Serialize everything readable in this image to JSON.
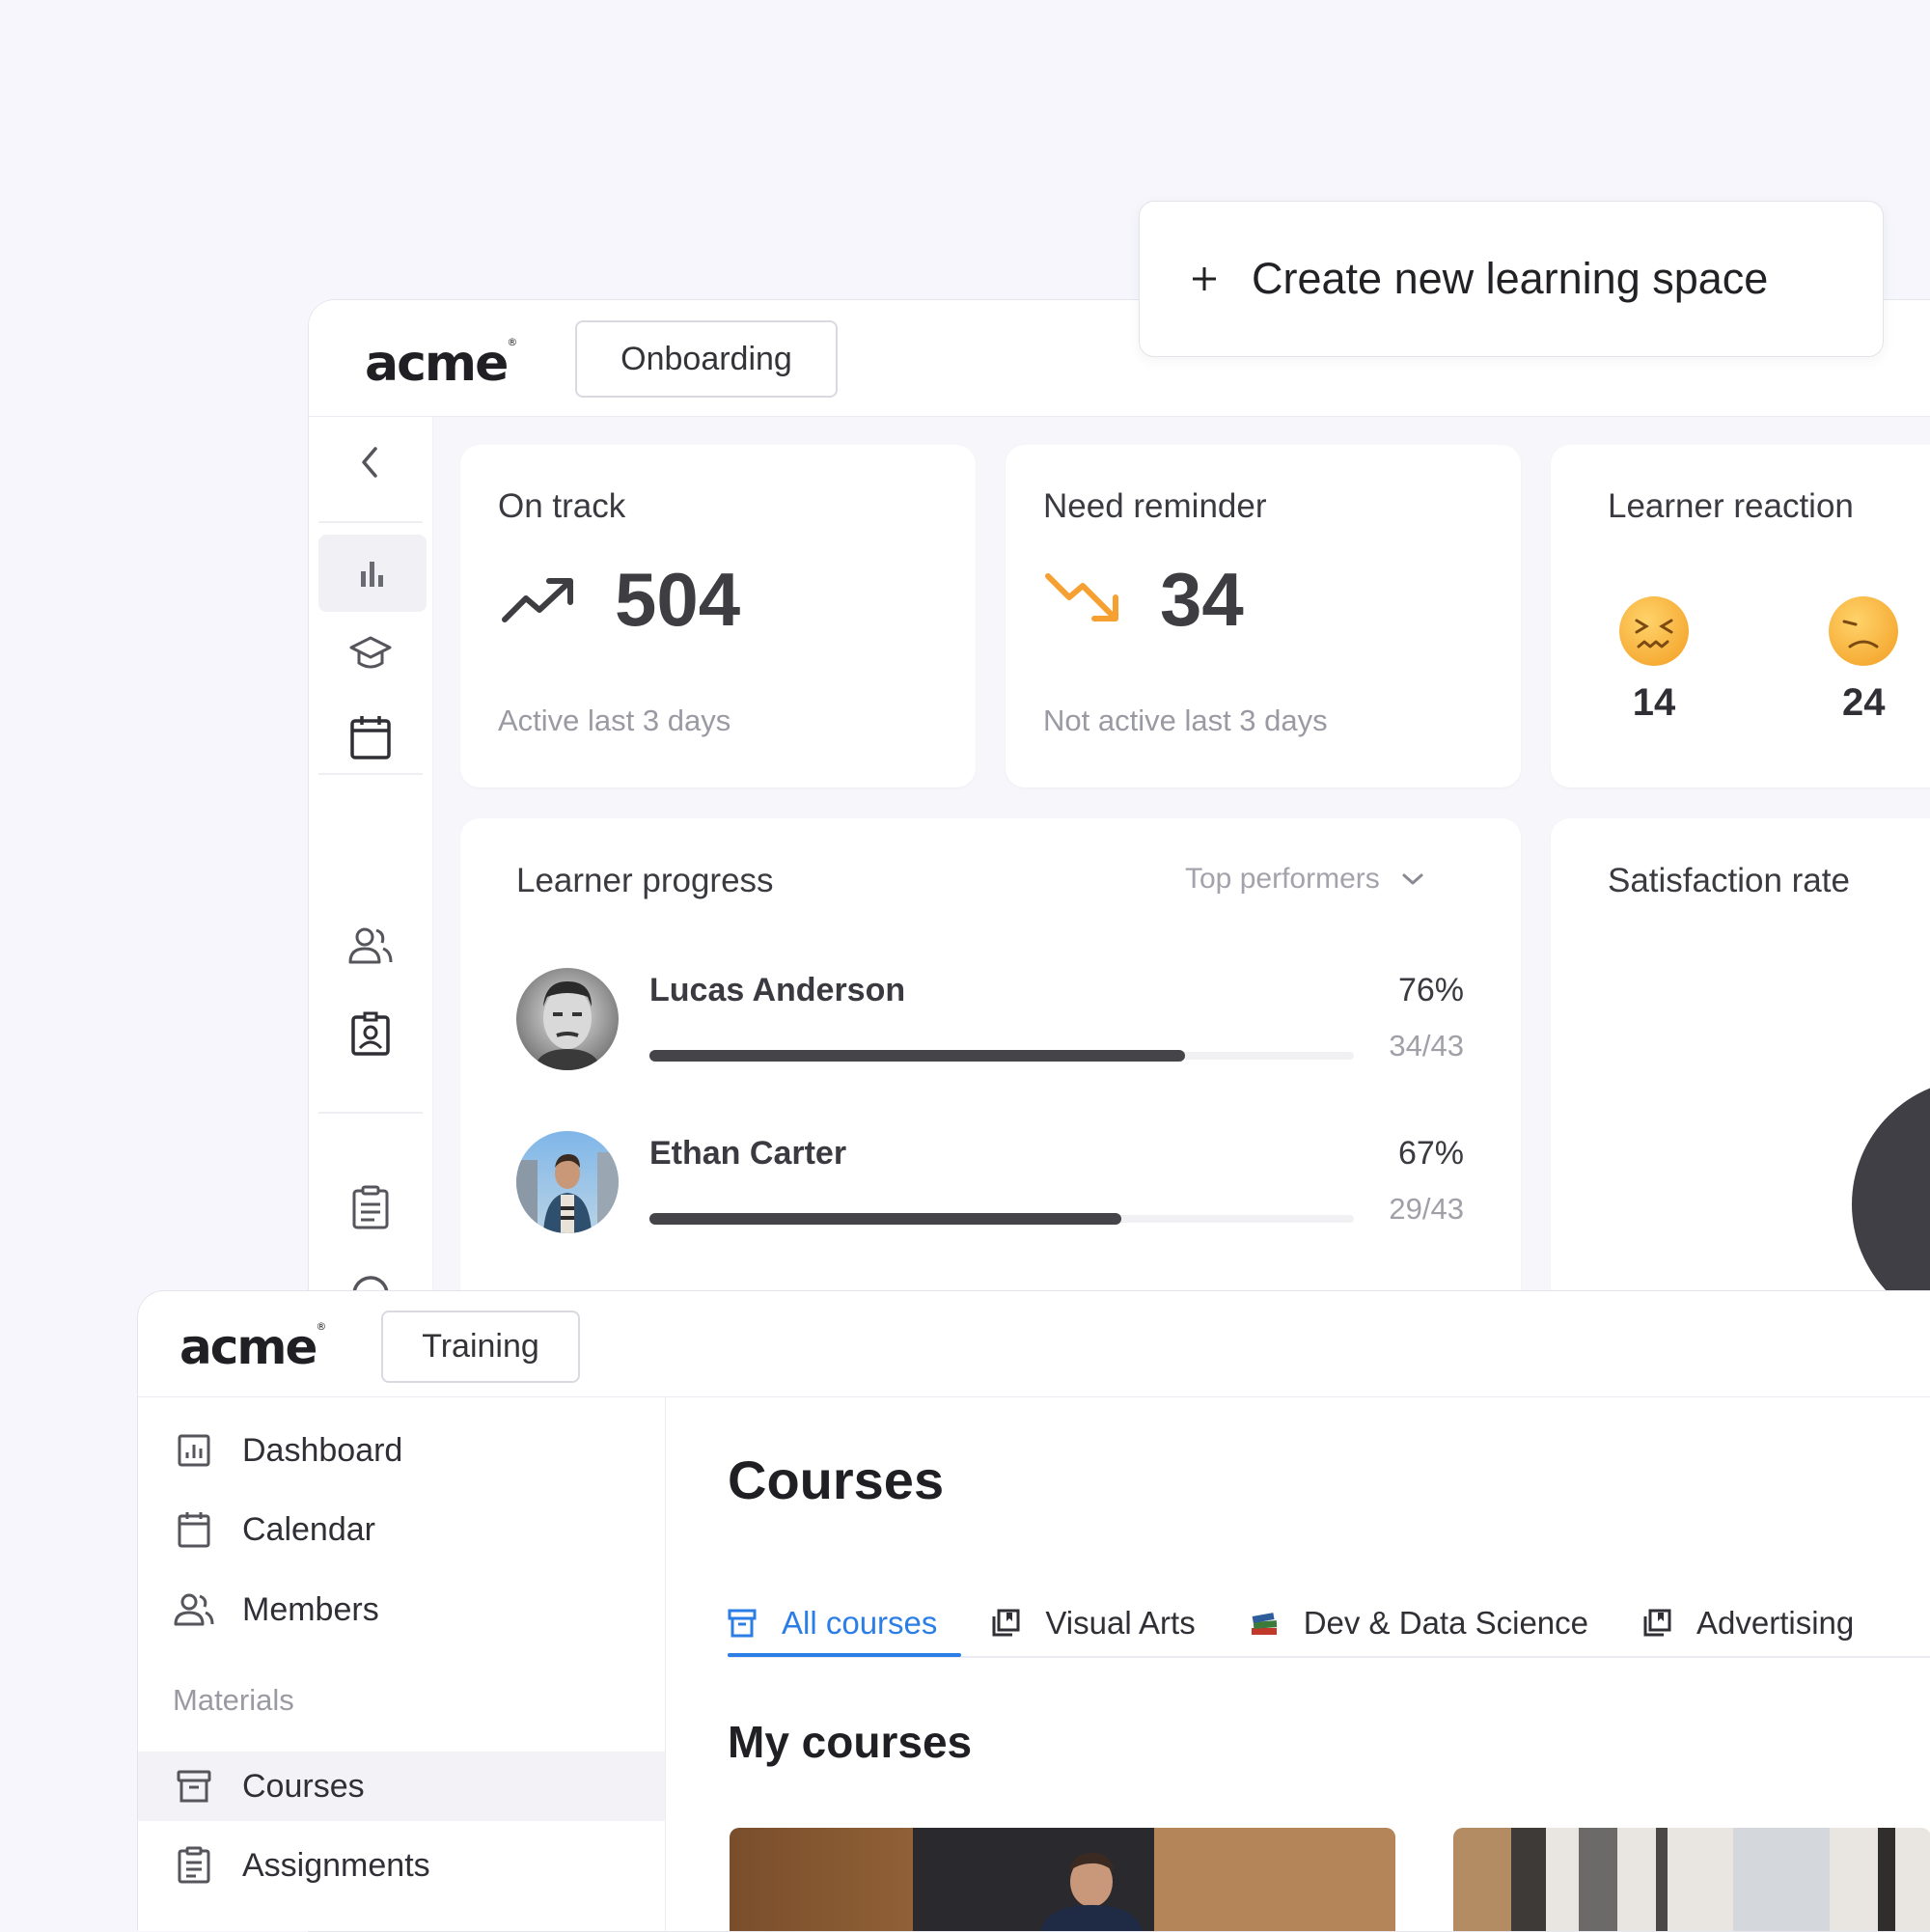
{
  "back_window": {
    "logo": "acme",
    "space_label": "Onboarding",
    "stats": {
      "on_track": {
        "title": "On track",
        "value": "504",
        "caption": "Active last 3 days"
      },
      "need_reminder": {
        "title": "Need reminder",
        "value": "34",
        "caption": "Not active last 3 days"
      },
      "learner_reaction": {
        "title": "Learner reaction",
        "counts": [
          "14",
          "24"
        ]
      }
    },
    "learner_progress": {
      "title": "Learner progress",
      "filter_label": "Top performers",
      "learners": [
        {
          "name": "Lucas Anderson",
          "percent_label": "76%",
          "fraction_label": "34/43",
          "progress": 0.76
        },
        {
          "name": "Ethan Carter",
          "percent_label": "67%",
          "fraction_label": "29/43",
          "progress": 0.67
        }
      ]
    },
    "satisfaction": {
      "title": "Satisfaction rate"
    }
  },
  "create_button": {
    "label": "Create new learning space"
  },
  "front_window": {
    "logo": "acme",
    "space_label": "Training",
    "nav": [
      {
        "label": "Dashboard",
        "icon": "dashboard-icon"
      },
      {
        "label": "Calendar",
        "icon": "calendar-icon"
      },
      {
        "label": "Members",
        "icon": "members-icon"
      }
    ],
    "section_label": "Materials",
    "materials_nav": [
      {
        "label": "Courses",
        "icon": "courses-icon",
        "active": true
      },
      {
        "label": "Assignments",
        "icon": "assignments-icon"
      }
    ],
    "page_title": "Courses",
    "tabs": [
      {
        "label": "All courses",
        "icon": "archive-icon",
        "active": true
      },
      {
        "label": "Visual Arts",
        "icon": "library-icon"
      },
      {
        "label": "Dev & Data Science",
        "icon": "books-icon"
      },
      {
        "label": "Advertising",
        "icon": "library-icon"
      }
    ],
    "section_title": "My courses"
  },
  "colors": {
    "accent": "#2b7ee6",
    "warning": "#f5a031",
    "progress_bar": "#444449",
    "background": "#f6f6fc"
  }
}
